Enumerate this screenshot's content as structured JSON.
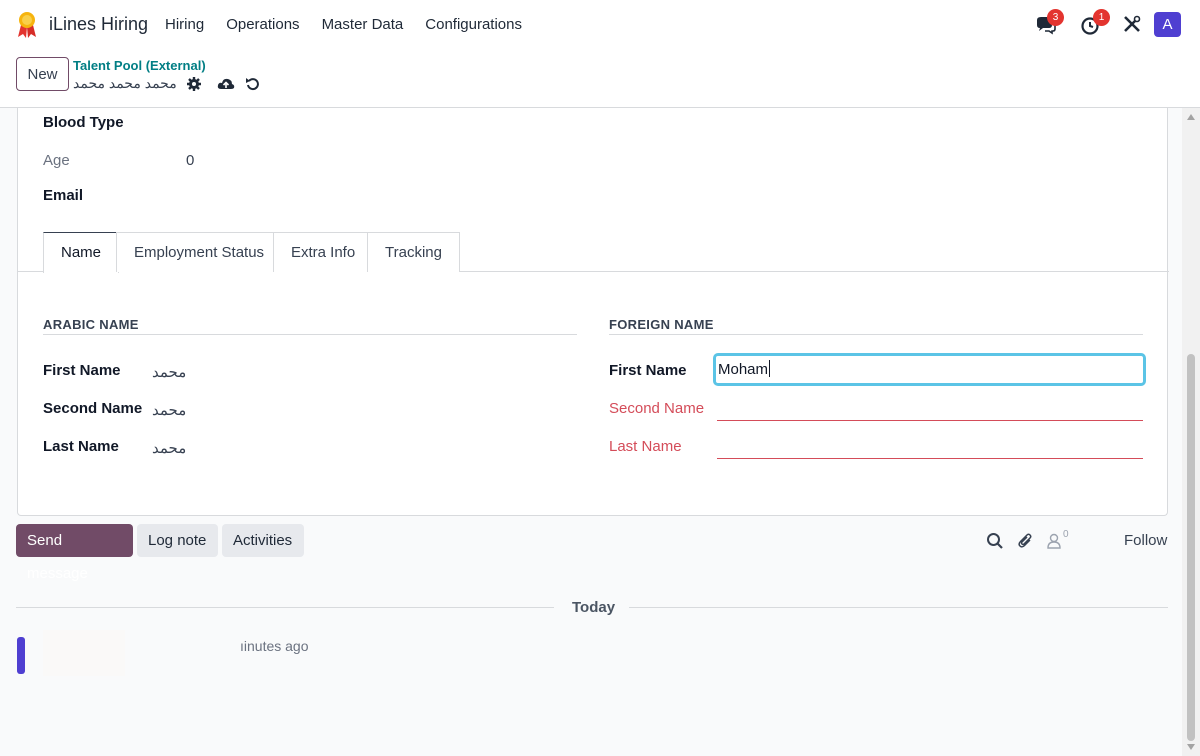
{
  "navbar": {
    "app_title": "iLines Hiring",
    "menu": [
      "Hiring",
      "Operations",
      "Master Data",
      "Configurations"
    ],
    "messages_count": "3",
    "activities_count": "1",
    "avatar_letter": "A"
  },
  "control_panel": {
    "new_label": "New",
    "breadcrumb": "Talent Pool (External)",
    "record_name": "محمد محمد محمد"
  },
  "form": {
    "blood_type_label": "Blood Type",
    "age_label": "Age",
    "age_value": "0",
    "email_label": "Email"
  },
  "tabs": [
    "Name",
    "Employment Status",
    "Extra Info",
    "Tracking"
  ],
  "arabic_name": {
    "section_title": "ARABIC NAME",
    "first_name_label": "First Name",
    "first_name_value": "محمد",
    "second_name_label": "Second Name",
    "second_name_value": "محمد",
    "last_name_label": "Last Name",
    "last_name_value": "محمد"
  },
  "foreign_name": {
    "section_title": "FOREIGN NAME",
    "first_name_label": "First Name",
    "first_name_value": "Moham",
    "second_name_label": "Second Name",
    "last_name_label": "Last Name"
  },
  "chatter": {
    "send_message": "Send message",
    "log_note": "Log note",
    "activities": "Activities",
    "followers_count": "0",
    "follow": "Follow",
    "today": "Today",
    "message_time": "ıinutes ago"
  },
  "colors": {
    "primary": "#714b67",
    "accent": "#017e84",
    "required_error": "#d44c59",
    "focus": "#5bc4e6",
    "avatar": "#4f3fd1"
  }
}
